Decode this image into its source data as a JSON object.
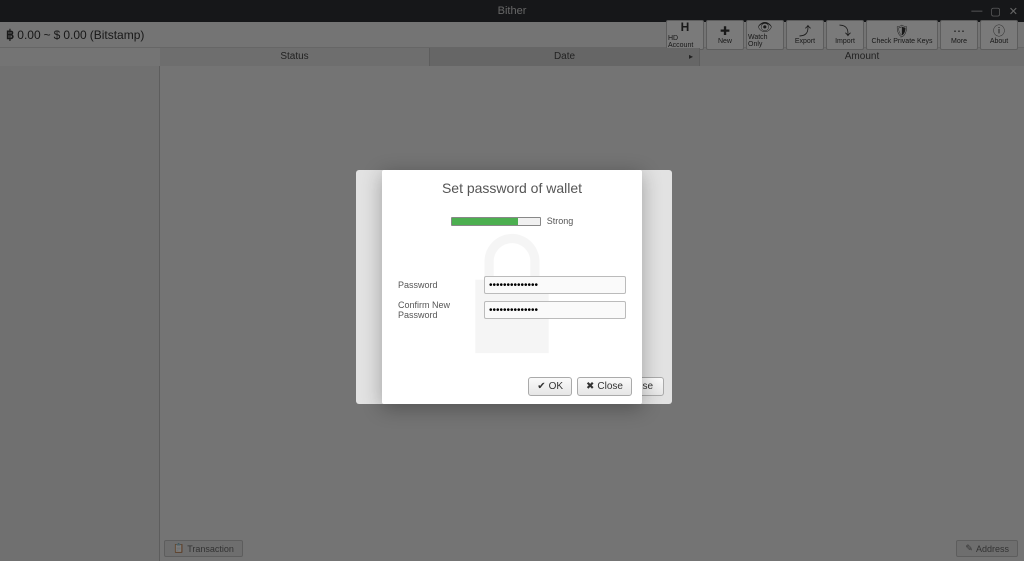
{
  "window": {
    "title": "Bither"
  },
  "balance": {
    "btc": "0.00",
    "separator": "~",
    "fiat_symbol": "$",
    "fiat": "0.00",
    "exchange": "(Bitstamp)"
  },
  "toolbar": {
    "hd_account": "HD Account",
    "new": "New",
    "watch_only": "Watch Only",
    "export": "Export",
    "import": "Import",
    "check_private_keys": "Check Private Keys",
    "more": "More",
    "about": "About"
  },
  "table": {
    "status": "Status",
    "date": "Date",
    "amount": "Amount"
  },
  "bottom": {
    "transaction": "Transaction",
    "address": "Address"
  },
  "dialog": {
    "title": "Set password of wallet",
    "strength_label": "Strong",
    "strength_percent": 75,
    "password_label": "Password",
    "confirm_label": "Confirm New Password",
    "password_value": "••••••••••••••",
    "confirm_value": "••••••••••••••",
    "ok": "OK",
    "close": "Close",
    "outer_close": "se"
  }
}
